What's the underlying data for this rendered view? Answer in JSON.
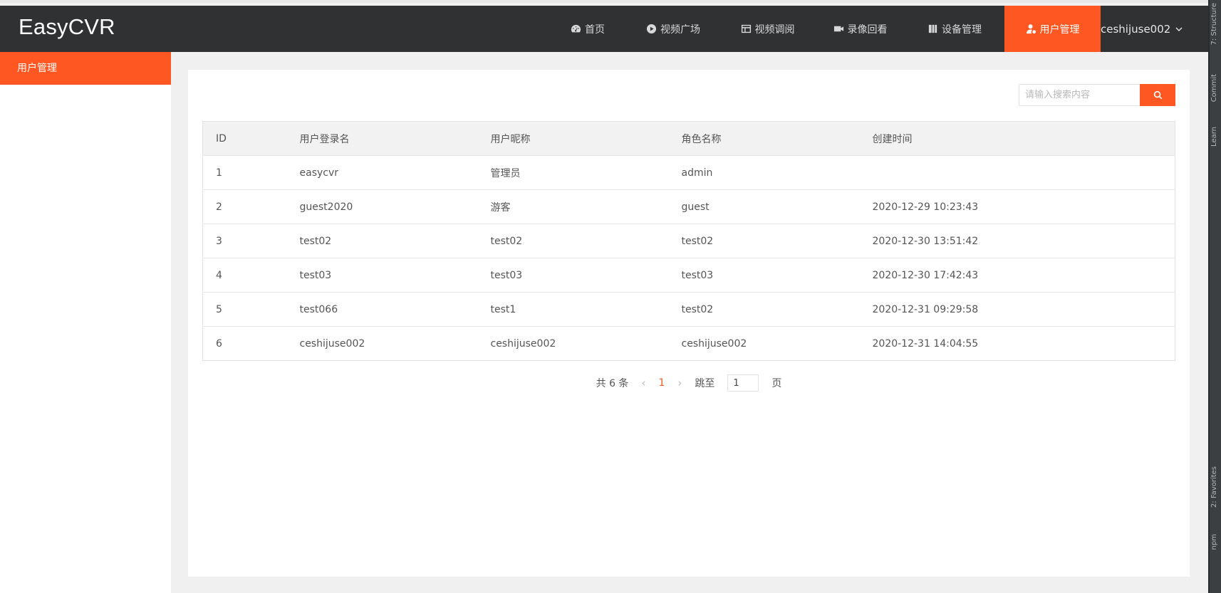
{
  "header": {
    "logo": "EasyCVR",
    "nav": [
      {
        "label": "首页",
        "icon": "dashboard-icon"
      },
      {
        "label": "视频广场",
        "icon": "play-circle-icon"
      },
      {
        "label": "视频调阅",
        "icon": "layout-icon"
      },
      {
        "label": "录像回看",
        "icon": "video-camera-icon"
      },
      {
        "label": "设备管理",
        "icon": "device-icon"
      },
      {
        "label": "用户管理",
        "icon": "user-icon",
        "active": true
      }
    ],
    "user": "ceshijuse002"
  },
  "sidebar": {
    "active_item": "用户管理"
  },
  "search": {
    "placeholder": "请输入搜索内容"
  },
  "table": {
    "columns": [
      "ID",
      "用户登录名",
      "用户昵称",
      "角色名称",
      "创建时间"
    ],
    "rows": [
      [
        "1",
        "easycvr",
        "管理员",
        "admin",
        ""
      ],
      [
        "2",
        "guest2020",
        "游客",
        "guest",
        "2020-12-29 10:23:43"
      ],
      [
        "3",
        "test02",
        "test02",
        "test02",
        "2020-12-30 13:51:42"
      ],
      [
        "4",
        "test03",
        "test03",
        "test03",
        "2020-12-30 17:42:43"
      ],
      [
        "5",
        "test066",
        "test1",
        "test02",
        "2020-12-31 09:29:58"
      ],
      [
        "6",
        "ceshijuse002",
        "ceshijuse002",
        "ceshijuse002",
        "2020-12-31 14:04:55"
      ]
    ]
  },
  "pagination": {
    "total_text": "共 6 条",
    "prev": "‹",
    "current": "1",
    "next": "›",
    "jump_label": "跳至",
    "jump_value": "1",
    "page_suffix": "页"
  },
  "dock": {
    "labels": [
      "7: Structure",
      "Commit",
      "Learn",
      "2: Favorites",
      "npm"
    ]
  },
  "colors": {
    "accent": "#ff5722",
    "header_bg": "#2f3133"
  }
}
